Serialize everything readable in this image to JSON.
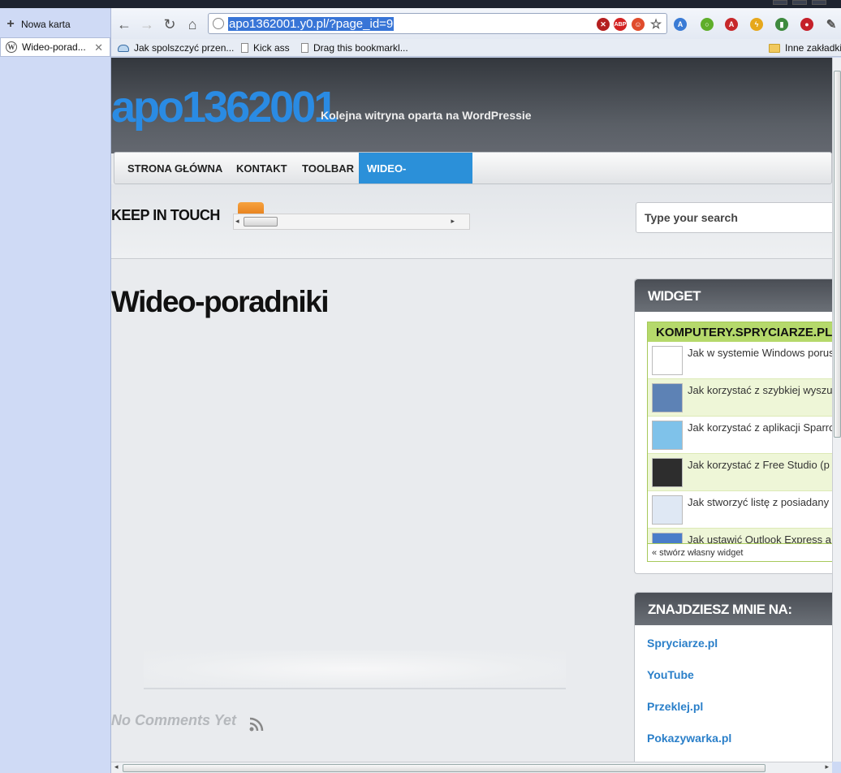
{
  "browser": {
    "new_tab_label": "Nowa karta",
    "tab_title": "Wideo-porad...",
    "url": "apo1362001.y0.pl/?page_id=9",
    "bookmarks": [
      {
        "label": "Jak spolszczyć przen...",
        "icon": "cloud-icon"
      },
      {
        "label": "Kick ass",
        "icon": "page-icon"
      },
      {
        "label": "Drag this bookmarkl...",
        "icon": "page-icon"
      }
    ],
    "other_bookmarks_label": "Inne zakładki"
  },
  "site": {
    "title": "apo1362001",
    "description": "Kolejna witryna oparta na WordPressie",
    "nav": [
      {
        "label": "STRONA GŁÓWNA",
        "active": false
      },
      {
        "label": "KONTAKT",
        "active": false
      },
      {
        "label": "TOOLBAR",
        "active": false
      },
      {
        "label": "WIDEO-PORADNIKI",
        "active": true
      }
    ],
    "keep_in_touch": "KEEP IN TOUCH",
    "search_placeholder": "Type your search"
  },
  "page": {
    "title": "Wideo-poradniki",
    "no_comments": "No Comments Yet"
  },
  "widget1": {
    "title": "WIDGET",
    "feed_title": "KOMPUTERY.SPRYCIARZE.PL",
    "items": [
      {
        "text": "Jak w systemie Windows porusz"
      },
      {
        "text": "Jak korzystać z szybkiej wyszuk"
      },
      {
        "text": "Jak korzystać z aplikacji Sparrow"
      },
      {
        "text": "Jak korzystać z Free Studio (p"
      },
      {
        "text": "Jak stworzyć listę z posiadany"
      },
      {
        "text": "Jak ustawić Outlook Express a"
      }
    ],
    "footer": "« stwórz własny widget"
  },
  "widget2": {
    "title": "ZNAJDZIESZ MNIE NA:",
    "links": [
      "Spryciarze.pl",
      "YouTube",
      "Przeklej.pl",
      "Pokazywarka.pl"
    ]
  },
  "colors": {
    "accent": "#2b90d9",
    "site_title": "#2a8be3",
    "feed_header": "#b5d96b"
  }
}
